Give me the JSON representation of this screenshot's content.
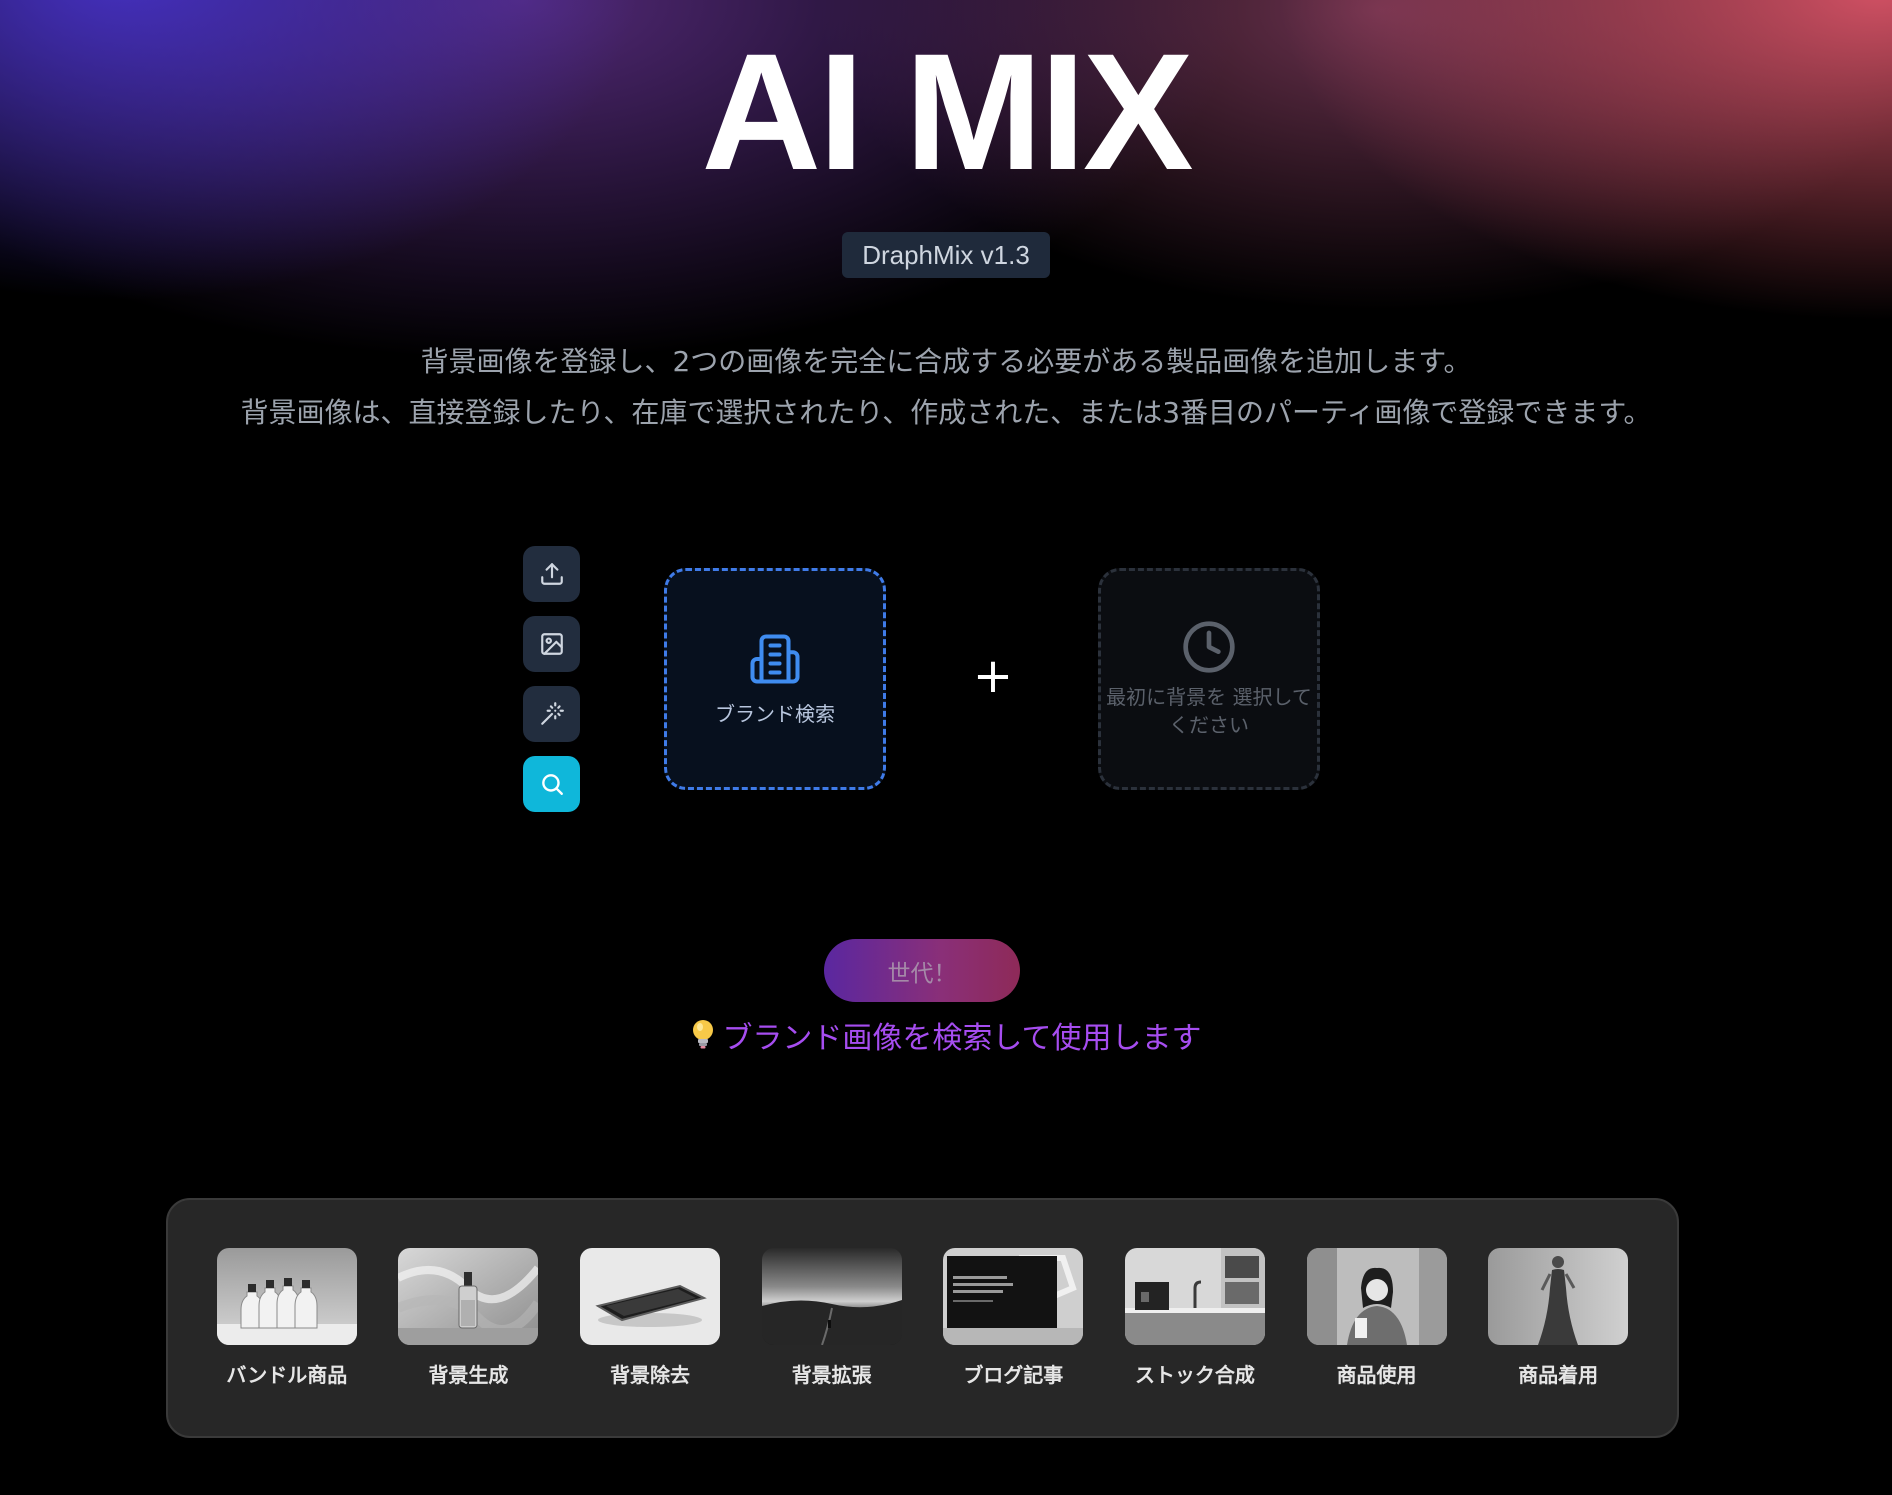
{
  "header": {
    "title": "AI MIX",
    "version": "DraphMix v1.3",
    "description_line1": "背景画像を登録し、2つの画像を完全に合成する必要がある製品画像を追加します。",
    "description_line2": "背景画像は、直接登録したり、在庫で選択されたり、作成された、または3番目のパーティ画像で登録できます。"
  },
  "tools": [
    {
      "icon": "upload-icon"
    },
    {
      "icon": "image-icon"
    },
    {
      "icon": "magic-wand-icon"
    },
    {
      "icon": "search-icon",
      "active": true
    }
  ],
  "slots": {
    "brand_label": "ブランド検索",
    "brand_icon": "building-icon",
    "background_label": "最初に背景を 選択してください",
    "background_icon": "clock-icon"
  },
  "plus_symbol": "+",
  "generate_button": "世代！",
  "hint": {
    "icon": "light-bulb-icon",
    "text": "ブランド画像を検索して使用します"
  },
  "features": [
    {
      "label": "バンドル商品"
    },
    {
      "label": "背景生成"
    },
    {
      "label": "背景除去"
    },
    {
      "label": "背景拡張"
    },
    {
      "label": "ブログ記事"
    },
    {
      "label": "ストック合成"
    },
    {
      "label": "商品使用"
    },
    {
      "label": "商品着用"
    }
  ],
  "colors": {
    "accent_cyan": "#0fb7da",
    "brand_slot_border": "#3f7be8",
    "hint_text": "#a64df0"
  }
}
